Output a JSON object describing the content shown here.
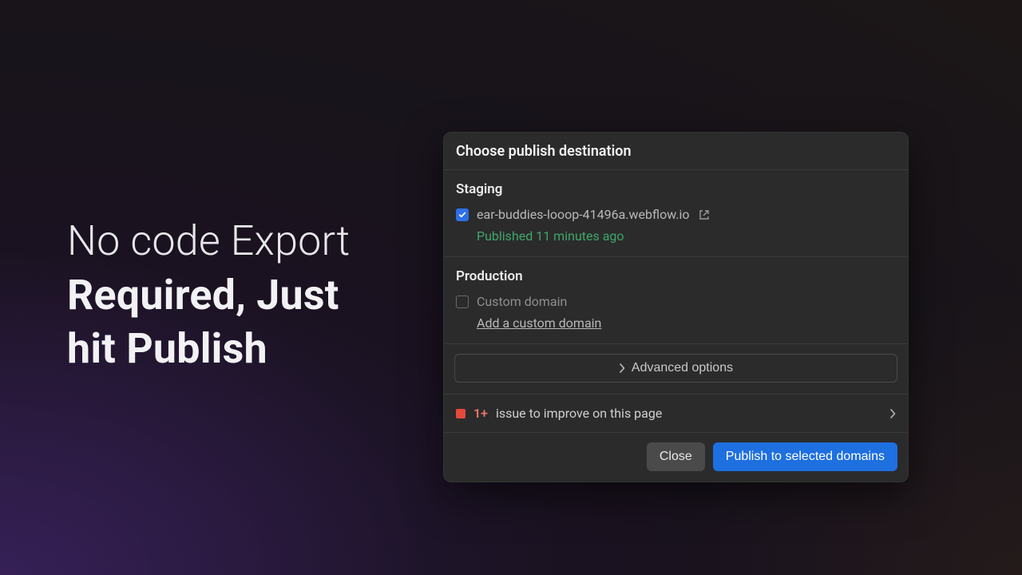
{
  "headline": {
    "line1": "No code Export",
    "line2": "Required, Just",
    "line3": "hit Publish"
  },
  "dialog": {
    "title": "Choose publish destination",
    "staging": {
      "heading": "Staging",
      "domain": "ear-buddies-looop-41496a.webflow.io",
      "checked": true,
      "status": "Published 11 minutes ago"
    },
    "production": {
      "heading": "Production",
      "custom_domain_label": "Custom domain",
      "checked": false,
      "add_link": "Add a custom domain"
    },
    "advanced_label": "Advanced options",
    "issues": {
      "count": "1+",
      "text": "issue to improve on this page"
    },
    "footer": {
      "close": "Close",
      "publish": "Publish to selected domains"
    }
  },
  "colors": {
    "accent": "#1e6fe0",
    "success": "#3fa66a",
    "error": "#e24a3b"
  }
}
